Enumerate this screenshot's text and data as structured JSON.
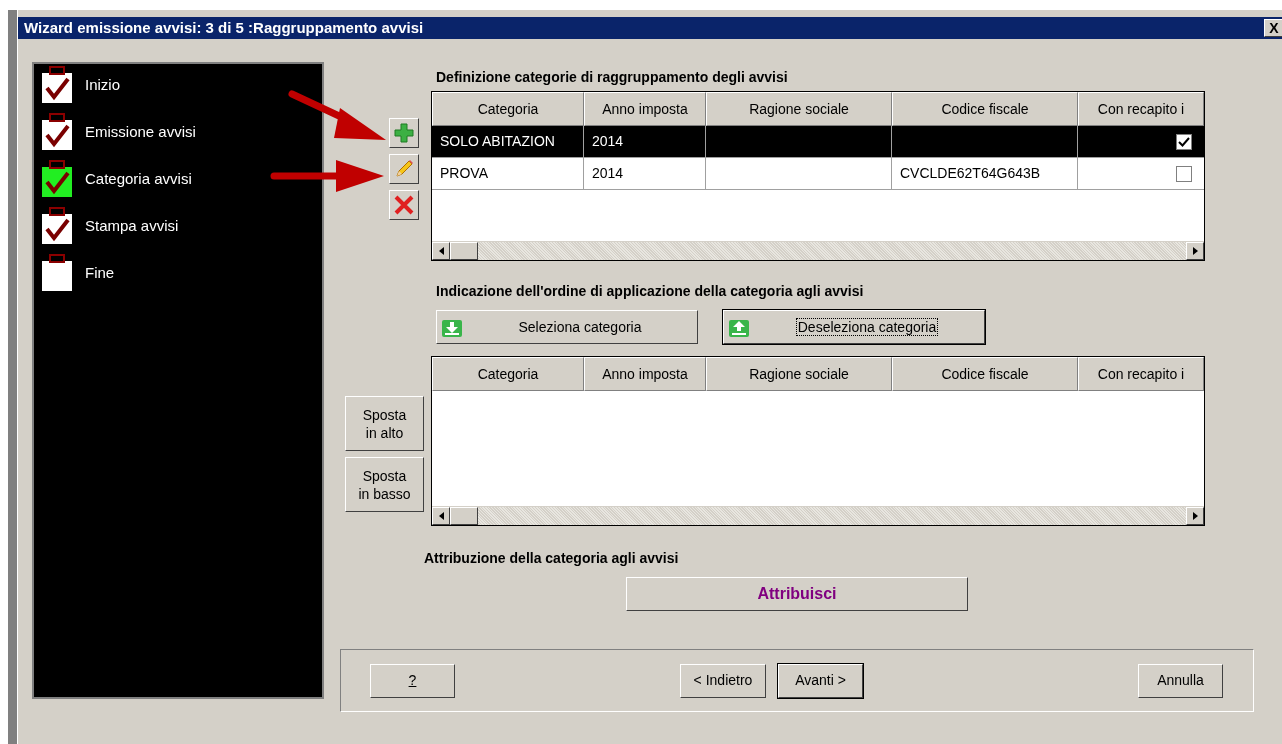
{
  "window": {
    "title": "Wizard emissione avvisi: 3 di 5 :Raggruppamento avvisi",
    "close": "X"
  },
  "steps": [
    {
      "label": "Inizio",
      "checked": true,
      "selected": false
    },
    {
      "label": "Emissione avvisi",
      "checked": true,
      "selected": false
    },
    {
      "label": "Categoria avvisi",
      "checked": true,
      "selected": true
    },
    {
      "label": "Stampa avvisi",
      "checked": true,
      "selected": false
    },
    {
      "label": "Fine",
      "checked": false,
      "selected": false
    }
  ],
  "categories": {
    "title": "Definizione categorie di raggruppamento degli avvisi",
    "columns": [
      "Categoria",
      "Anno imposta",
      "Ragione sociale",
      "Codice fiscale",
      "Con recapito i"
    ],
    "rows": [
      {
        "selected": true,
        "categoria": "SOLO ABITAZION",
        "anno_imposta": "2014",
        "con_recapito": true
      },
      {
        "selected": false,
        "categoria": "PROVA",
        "anno_imposta": "2014",
        "codice_fiscale": "CVCLDE62T64G643B",
        "con_recapito": false
      }
    ]
  },
  "order": {
    "title": "Indicazione dell'ordine di applicazione della categoria agli avvisi",
    "select_button": "Seleziona categoria",
    "deselect_button": "Deseleziona categoria",
    "columns": [
      "Categoria",
      "Anno imposta",
      "Ragione sociale",
      "Codice fiscale",
      "Con recapito i"
    ],
    "move_up": "Sposta in alto",
    "move_down": "Sposta in basso"
  },
  "assign": {
    "title": "Attribuzione della categoria agli avvisi",
    "button": "Attribuisci"
  },
  "footer": {
    "help": "?",
    "back": "< Indietro",
    "next": "Avanti >",
    "cancel": "Annulla"
  }
}
